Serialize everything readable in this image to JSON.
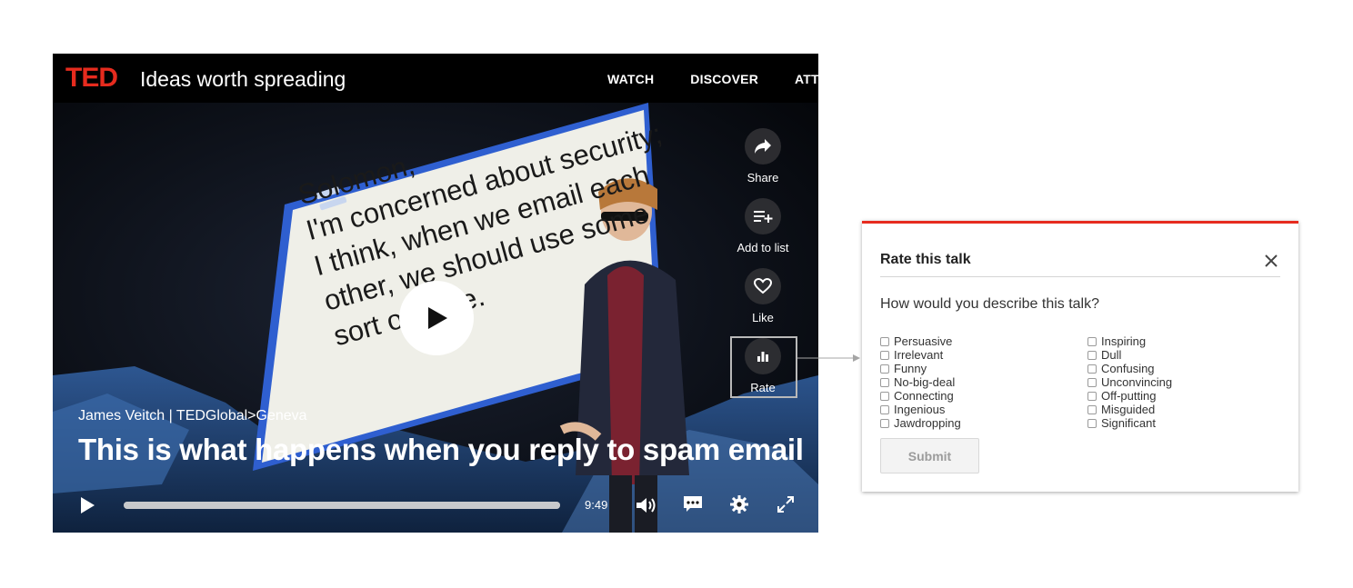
{
  "header": {
    "logo": "TED",
    "tagline": "Ideas worth spreading",
    "nav": [
      "WATCH",
      "DISCOVER",
      "ATTE"
    ]
  },
  "slide": {
    "lines": [
      "Solomon,",
      "I'm concerned about security;",
      "I think, when we email each",
      "other, we should use some",
      "sort of code."
    ]
  },
  "actions": {
    "share": "Share",
    "add_to_list": "Add to list",
    "like": "Like",
    "rate": "Rate"
  },
  "video": {
    "speaker": "James Veitch | TEDGlobal>Geneva",
    "title": "This is what happens when you reply to spam email",
    "duration": "9:49",
    "progress": 1.0
  },
  "dialog": {
    "title": "Rate this talk",
    "question": "How would you describe this talk?",
    "left_options": [
      "Persuasive",
      "Irrelevant",
      "Funny",
      "No-big-deal",
      "Connecting",
      "Ingenious",
      "Jawdropping"
    ],
    "right_options": [
      "Inspiring",
      "Dull",
      "Confusing",
      "Unconvincing",
      "Off-putting",
      "Misguided",
      "Significant"
    ],
    "submit": "Submit"
  },
  "colors": {
    "ted_red": "#e62b1e",
    "slide_blue": "#2f5fd0"
  }
}
